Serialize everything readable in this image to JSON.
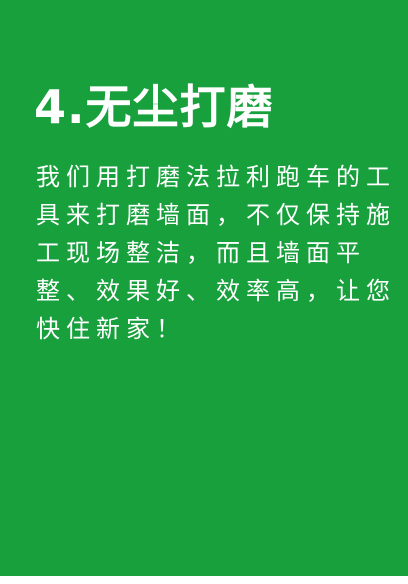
{
  "title": "4.无尘打磨",
  "body": {
    "lines": [
      "我们用打磨法拉利跑车的工",
      "具来打磨墙面，不仅保持施",
      "工现场整洁，而且墙面平",
      "整、效果好、效率高，让您",
      "快住新家！"
    ]
  },
  "colors": {
    "background": "#17a03c",
    "text": "#ffffff"
  }
}
